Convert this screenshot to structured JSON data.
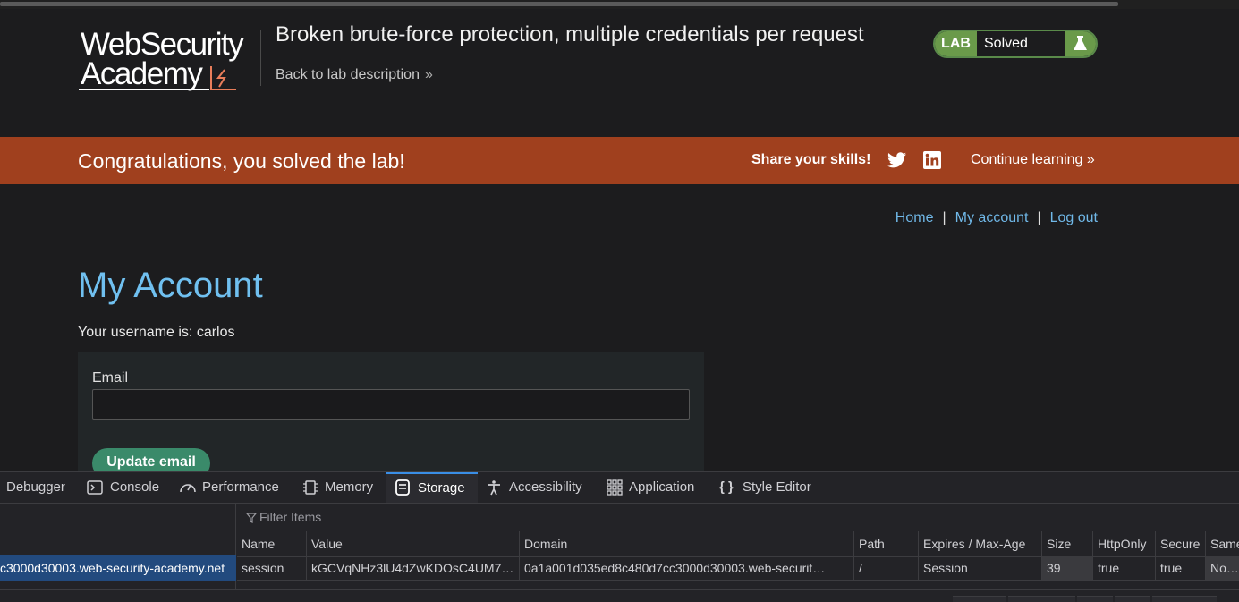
{
  "header": {
    "logo_line1": "WebSecurity",
    "logo_line2": "Academy",
    "lab_title": "Broken brute-force protection, multiple credentials per request",
    "back_link": "Back to lab description",
    "lab_badge": {
      "label": "LAB",
      "status": "Solved"
    }
  },
  "banner": {
    "congrats": "Congratulations, you solved the lab!",
    "share": "Share your skills!",
    "continue": "Continue learning"
  },
  "nav": {
    "home": "Home",
    "sep": "|",
    "my_account": "My account",
    "log_out": "Log out"
  },
  "main": {
    "title": "My Account",
    "username_text": "Your username is: carlos",
    "email_label": "Email",
    "email_value": "",
    "update_button": "Update email"
  },
  "devtools": {
    "tabs": [
      "Debugger",
      "Console",
      "Performance",
      "Memory",
      "Storage",
      "Accessibility",
      "Application",
      "Style Editor"
    ],
    "active_tab": "Storage",
    "host": "c3000d30003.web-security-academy.net",
    "filter_placeholder": "Filter Items",
    "columns": [
      "Name",
      "Value",
      "Domain",
      "Path",
      "Expires / Max-Age",
      "Size",
      "HttpOnly",
      "Secure",
      "Same"
    ],
    "cookie": {
      "name": "session",
      "value": "kGCVqNHz3lU4dZwKDOsC4UM7…",
      "domain": "0a1a001d035ed8c480d7cc3000d30003.web-securit…",
      "path": "/",
      "expires": "Session",
      "size": "39",
      "httponly": "true",
      "secure": "true",
      "samesite": "None"
    }
  },
  "colors": {
    "banner": "#a0401e",
    "accent_blue": "#70c0f0",
    "lab_green": "#6a9a4a",
    "button_green": "#3a8a6a",
    "devtools_select": "#224a7e"
  }
}
